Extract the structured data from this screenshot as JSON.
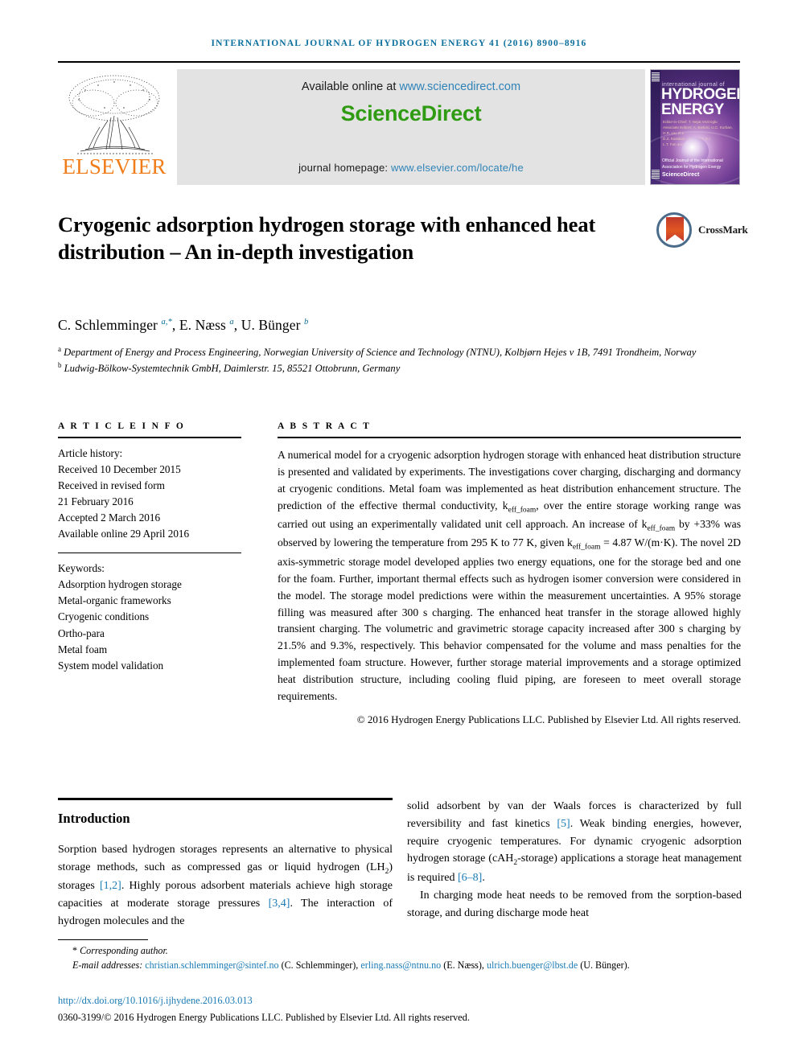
{
  "running_head": "International Journal of Hydrogen Energy 41 (2016) 8900–8916",
  "masthead": {
    "publisher_logo_text": "ELSEVIER",
    "available_prefix": "Available online at ",
    "available_link": "www.sciencedirect.com",
    "sciencedirect_logo": "ScienceDirect",
    "homepage_prefix": "journal homepage: ",
    "homepage_link": "www.elsevier.com/locate/he",
    "cover": {
      "line_small": "international journal of",
      "line1": "HYDROGEN",
      "line2": "ENERGY",
      "editors": "Editor-in-Chief: T. Nejat Veziroglu\nAssociate Editors: A. Bielicki, U.C. Kurban, H.R. Liu, D.L.\nD.Z. Karakus, I.M. Bellini, E.I.\nL.T. Fan and D.C. Vuduglu",
      "footer_note": "Official Journal of the International\nAssociation for Hydrogen Energy",
      "footer_sd": "ScienceDirect"
    }
  },
  "crossmark": {
    "label": "CrossMark"
  },
  "article": {
    "title": "Cryogenic adsorption hydrogen storage with enhanced heat distribution – An in-depth investigation",
    "authors_html": "C. Schlemminger <sup>a,*</sup>, E. Næss <sup>a</sup>, U. Bünger <sup>b</sup>",
    "affiliations": [
      {
        "marker": "a",
        "text": "Department of Energy and Process Engineering, Norwegian University of Science and Technology (NTNU), Kolbjørn Hejes v 1B, 7491 Trondheim, Norway"
      },
      {
        "marker": "b",
        "text": "Ludwig-Bölkow-Systemtechnik GmbH, Daimlerstr. 15, 85521 Ottobrunn, Germany"
      }
    ]
  },
  "article_info": {
    "heading": "A R T I C L E   I N F O",
    "history_label": "Article history:",
    "history": [
      "Received 10 December 2015",
      "Received in revised form",
      "21 February 2016",
      "Accepted 2 March 2016",
      "Available online 29 April 2016"
    ],
    "keywords_label": "Keywords:",
    "keywords": [
      "Adsorption hydrogen storage",
      "Metal-organic frameworks",
      "Cryogenic conditions",
      "Ortho-para",
      "Metal foam",
      "System model validation"
    ]
  },
  "abstract": {
    "heading": "A B S T R A C T",
    "text_html": "A numerical model for a cryogenic adsorption hydrogen storage with enhanced heat distribution structure is presented and validated by experiments. The investigations cover charging, discharging and dormancy at cryogenic conditions. Metal foam was implemented as heat distribution enhancement structure. The prediction of the effective thermal conductivity, k<sub>eff_foam</sub>, over the entire storage working range was carried out using an experimentally validated unit cell approach. An increase of k<sub>eff_foam</sub> by +33% was observed by lowering the temperature from 295 K to 77 K, given k<sub>eff_foam</sub> = 4.87 W/(m&middot;K). The novel 2D axis-symmetric storage model developed applies two energy equations, one for the storage bed and one for the foam. Further, important thermal effects such as hydrogen isomer conversion were considered in the model. The storage model predictions were within the measurement uncertainties. A 95% storage filling was measured after 300 s charging. The enhanced heat transfer in the storage allowed highly transient charging. The volumetric and gravimetric storage capacity increased after 300 s charging by 21.5% and 9.3%, respectively. This behavior compensated for the volume and mass penalties for the implemented foam structure. However, further storage material improvements and a storage optimized heat distribution structure, including cooling fluid piping, are foreseen to meet overall storage requirements.",
    "copyright": "© 2016 Hydrogen Energy Publications LLC. Published by Elsevier Ltd. All rights reserved."
  },
  "body": {
    "intro_heading": "Introduction",
    "left_col_html": "Sorption based hydrogen storages represents an alternative to physical storage methods, such as compressed gas or liquid hydrogen (LH<sub>2</sub>) storages <span class=\"ref\">[1,2]</span>. Highly porous adsorbent materials achieve high storage capacities at moderate storage pressures <span class=\"ref\">[3,4]</span>. The interaction of hydrogen molecules and the",
    "right_col_html": "solid adsorbent by van der Waals forces is characterized by full reversibility and fast kinetics <span class=\"ref\">[5]</span>. Weak binding energies, however, require cryogenic temperatures. For dynamic cryogenic adsorption hydrogen storage (cAH<sub>2</sub>-storage) applications a storage heat management is required <span class=\"ref\">[6–8]</span>.",
    "right_col_p2_html": "In charging mode heat needs to be removed from the sorption-based storage, and during discharge mode heat"
  },
  "footer": {
    "corresponding": "Corresponding author.",
    "corresponding_star": "*",
    "email_label": "E-mail addresses: ",
    "emails": [
      {
        "address": "christian.schlemminger@sintef.no",
        "owner": " (C. Schlemminger), "
      },
      {
        "address": "erling.nass@ntnu.no",
        "owner": " (E. Næss), "
      },
      {
        "address": "ulrich.buenger@lbst.de",
        "owner": " (U. Bünger)."
      }
    ],
    "doi": "http://dx.doi.org/10.1016/j.ijhydene.2016.03.013",
    "issn_line": "0360-3199/© 2016 Hydrogen Energy Publications LLC. Published by Elsevier Ltd. All rights reserved."
  },
  "colors": {
    "header_teal": "#0b6f9d",
    "link_blue": "#1b7bb5",
    "sciencedirect_green": "#2e9b12",
    "elsevier_orange": "#f07d1a",
    "crossmark_red": "#c0392b"
  }
}
